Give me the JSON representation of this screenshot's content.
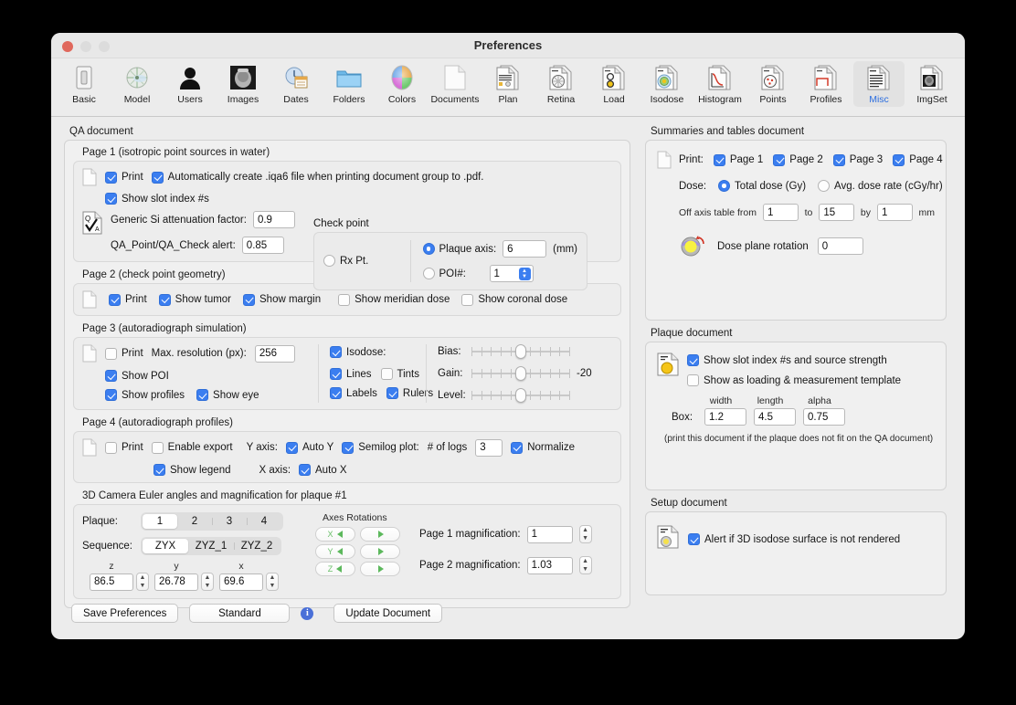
{
  "window": {
    "title": "Preferences"
  },
  "toolbar": {
    "items": [
      {
        "label": "Basic",
        "icon": "switch-icon"
      },
      {
        "label": "Model",
        "icon": "eye-model-icon"
      },
      {
        "label": "Users",
        "icon": "person-icon"
      },
      {
        "label": "Images",
        "icon": "scan-image-icon"
      },
      {
        "label": "Dates",
        "icon": "calendar-clock-icon"
      },
      {
        "label": "Folders",
        "icon": "folder-icon"
      },
      {
        "label": "Colors",
        "icon": "color-wheel-icon"
      },
      {
        "label": "Documents",
        "icon": "document-icon"
      },
      {
        "label": "Plan",
        "icon": "plan-doc-icon"
      },
      {
        "label": "Retina",
        "icon": "retina-doc-icon"
      },
      {
        "label": "Load",
        "icon": "load-doc-icon"
      },
      {
        "label": "Isodose",
        "icon": "isodose-doc-icon"
      },
      {
        "label": "Histogram",
        "icon": "histogram-doc-icon"
      },
      {
        "label": "Points",
        "icon": "points-doc-icon"
      },
      {
        "label": "Profiles",
        "icon": "profiles-doc-icon"
      },
      {
        "label": "Misc",
        "icon": "misc-doc-icon"
      },
      {
        "label": "ImgSet",
        "icon": "imgset-doc-icon"
      }
    ],
    "active_index": 15
  },
  "qa_document": {
    "group_label": "QA document",
    "page1": {
      "label": "Page 1 (isotropic point sources in water)",
      "print_label": "Print",
      "print_checked": true,
      "auto_iqa6_label": "Automatically create .iqa6 file when printing document group to .pdf.",
      "auto_iqa6_checked": true,
      "show_slot_label": "Show slot index #s",
      "show_slot_checked": true,
      "atten_label": "Generic Si attenuation factor:",
      "atten_value": "0.9",
      "alert_label": "QA_Point/QA_Check alert:",
      "alert_value": "0.85",
      "check_point": {
        "label": "Check point",
        "rx_label": "Rx Pt.",
        "rx_selected": false,
        "plaque_label": "Plaque axis:",
        "plaque_selected": true,
        "plaque_value": "6",
        "plaque_unit": "(mm)",
        "poi_label": "POI#:",
        "poi_selected": false,
        "poi_value": "1"
      }
    },
    "page2": {
      "label": "Page 2 (check point geometry)",
      "checks": [
        {
          "label": "Print",
          "checked": true
        },
        {
          "label": "Show tumor",
          "checked": true
        },
        {
          "label": "Show margin",
          "checked": true
        },
        {
          "label": "Show meridian dose",
          "checked": false
        },
        {
          "label": "Show coronal dose",
          "checked": false
        }
      ]
    },
    "page3": {
      "label": "Page 3 (autoradiograph simulation)",
      "print_label": "Print",
      "print_checked": false,
      "maxres_label": "Max. resolution (px):",
      "maxres_value": "256",
      "show_poi_label": "Show POI",
      "show_poi_checked": true,
      "show_profiles_label": "Show  profiles",
      "show_profiles_checked": true,
      "show_eye_label": "Show eye",
      "show_eye_checked": true,
      "isodose_label": "Isodose:",
      "isodose_checked": true,
      "lines_label": "Lines",
      "lines_checked": true,
      "tints_label": "Tints",
      "tints_checked": false,
      "labels_label": "Labels",
      "labels_checked": true,
      "rulers_label": "Rulers",
      "rulers_checked": true,
      "bias_label": "Bias:",
      "gain_label": "Gain:",
      "gain_value": "-20",
      "level_label": "Level:"
    },
    "page4": {
      "label": "Page 4 (autoradiograph profiles)",
      "print_label": "Print",
      "print_checked": false,
      "export_label": "Enable export",
      "export_checked": false,
      "yaxis_label": "Y axis:",
      "autoy_label": "Auto Y",
      "autoy_checked": true,
      "semilog_label": "Semilog plot:",
      "semilog_checked": true,
      "logs_label": "# of logs",
      "logs_value": "3",
      "normalize_label": "Normalize",
      "normalize_checked": true,
      "legend_label": "Show legend",
      "legend_checked": true,
      "xaxis_label": "X axis:",
      "autox_label": "Auto X",
      "autox_checked": true
    },
    "camera": {
      "label": "3D Camera Euler angles and magnification for plaque #1",
      "plaque_label": "Plaque:",
      "plaque_options": [
        "1",
        "2",
        "3",
        "4"
      ],
      "plaque_selected": 0,
      "sequence_label": "Sequence:",
      "sequence_options": [
        "ZYX",
        "ZYZ_1",
        "ZYZ_2"
      ],
      "sequence_selected": 0,
      "angles": [
        {
          "axis": "z",
          "value": "86.5"
        },
        {
          "axis": "y",
          "value": "26.78"
        },
        {
          "axis": "x",
          "value": "69.6"
        }
      ],
      "axes_rotations_label": "Axes Rotations",
      "axes": [
        "X",
        "Y",
        "Z"
      ],
      "page1_mag_label": "Page 1 magnification:",
      "page1_mag_value": "1",
      "page2_mag_label": "Page 2 magnification:",
      "page2_mag_value": "1.03"
    }
  },
  "summaries_document": {
    "group_label": "Summaries and tables document",
    "print_label": "Print:",
    "pages": [
      {
        "label": "Page 1",
        "checked": true
      },
      {
        "label": "Page 2",
        "checked": true
      },
      {
        "label": "Page 3",
        "checked": true
      },
      {
        "label": "Page 4",
        "checked": true
      }
    ],
    "dose_label": "Dose:",
    "dose_total_label": "Total dose (Gy)",
    "dose_total_selected": true,
    "dose_rate_label": "Avg. dose rate (cGy/hr)",
    "dose_rate_selected": false,
    "offaxis_from_label": "Off axis table from",
    "offaxis_from": "1",
    "offaxis_to_label": "to",
    "offaxis_to": "15",
    "offaxis_by_label": "by",
    "offaxis_by": "1",
    "offaxis_unit": "mm",
    "rotation_label": "Dose plane rotation",
    "rotation_value": "0"
  },
  "plaque_document": {
    "group_label": "Plaque document",
    "slot_label": "Show slot index #s and source strength",
    "slot_checked": true,
    "template_label": "Show as loading & measurement template",
    "template_checked": false,
    "col_width": "width",
    "col_length": "length",
    "col_alpha": "alpha",
    "box_label": "Box:",
    "box_width": "1.2",
    "box_length": "4.5",
    "box_alpha": "0.75",
    "note": "(print this document if the plaque does not fit on the QA document)"
  },
  "setup_document": {
    "group_label": "Setup document",
    "alert_label": "Alert if 3D isodose surface is not rendered",
    "alert_checked": true
  },
  "footer": {
    "save_label": "Save Preferences",
    "standard_label": "Standard",
    "info_label": "i",
    "update_label": "Update Document"
  },
  "colors": {
    "accent": "#3b7ef0",
    "active_tab_text": "#2d6fe0",
    "window_bg": "#ececec",
    "close_button": "#e0685c"
  }
}
